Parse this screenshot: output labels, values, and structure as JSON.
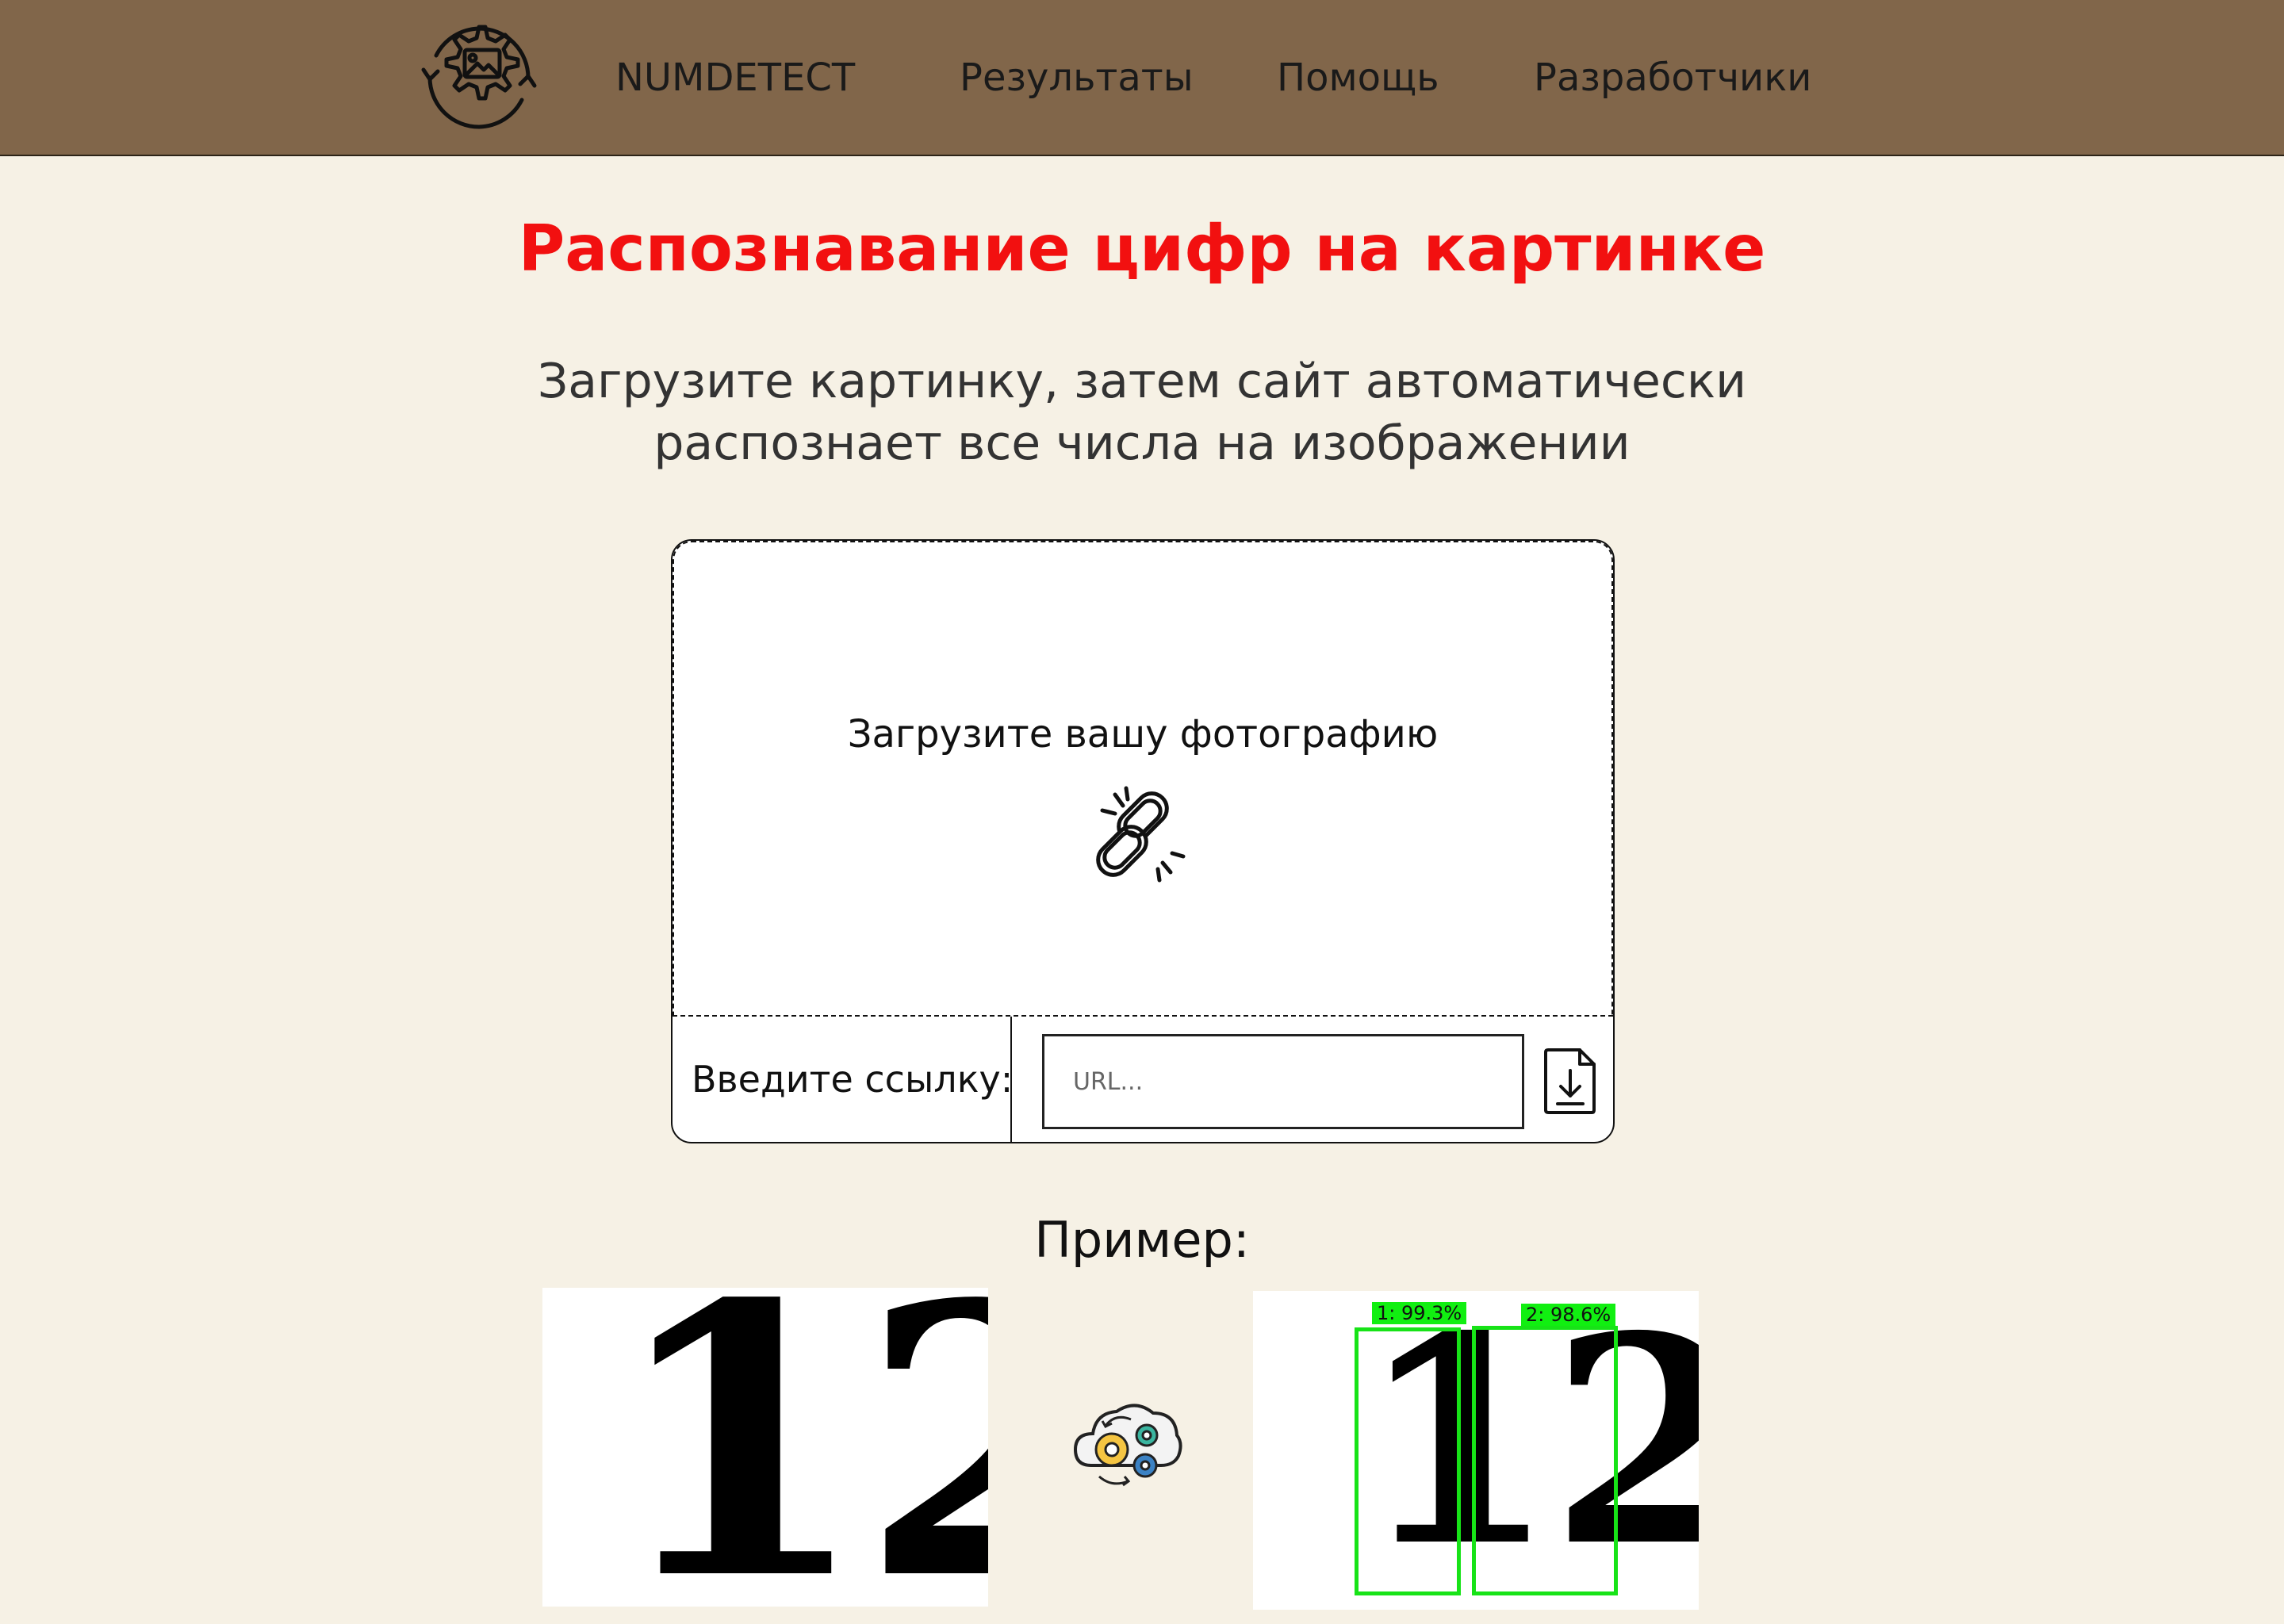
{
  "header": {
    "brand": "NUMDETECT",
    "nav": [
      {
        "label": "Результаты"
      },
      {
        "label": "Помощь"
      },
      {
        "label": "Разработчики"
      }
    ],
    "logo_icon": "gear-image-sync-icon",
    "background_color": "#81664a"
  },
  "main": {
    "title": "Распознавание цифр на картинке",
    "title_color": "#f21010",
    "subtitle_line1": "Загрузите картинку, затем сайт автоматически",
    "subtitle_line2": "распознает все числа на изображении"
  },
  "upload": {
    "drop_label": "Загрузите вашу фотографию",
    "drop_icon": "broken-link-icon",
    "url_label": "Введите ссылку:",
    "url_placeholder": "URL...",
    "download_icon": "file-download-icon"
  },
  "example": {
    "title": "Пример:",
    "input_digits": "12",
    "output_digits": "12",
    "process_icon": "cloud-gears-icon",
    "detections": [
      {
        "label": "1: 99.3%"
      },
      {
        "label": "2: 98.6%"
      }
    ],
    "detection_color": "#17e317"
  }
}
